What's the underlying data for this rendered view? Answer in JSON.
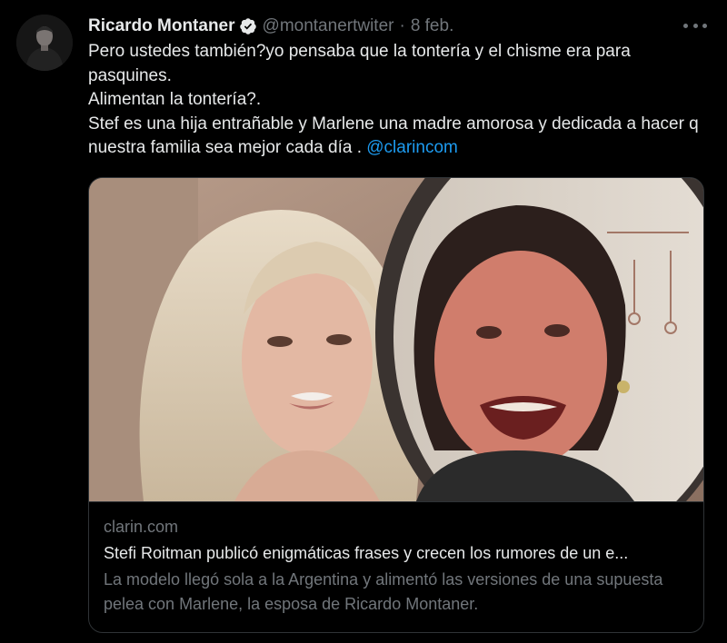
{
  "tweet": {
    "display_name": "Ricardo Montaner",
    "handle": "@montanertwiter",
    "separator": "·",
    "time": "8 feb.",
    "lines": [
      "Pero ustedes también?yo pensaba que la tontería y el chisme era para pasquines.",
      "Alimentan la tontería?.",
      "Stef es una hija entrañable y Marlene una madre amorosa y dedicada a hacer q nuestra familia sea mejor cada día . "
    ],
    "mention": "@clarincom"
  },
  "card": {
    "domain": "clarin.com",
    "title": "Stefi Roitman publicó enigmáticas frases y crecen los rumores de un e...",
    "description": "La modelo llegó sola a la Argentina y alimentó las versiones de una supuesta pelea con Marlene, la esposa de Ricardo Montaner."
  },
  "colors": {
    "background": "#000000",
    "text": "#e7e9ea",
    "secondary": "#71767b",
    "link": "#1d9bf0",
    "border": "#2f3336"
  },
  "icons": [
    "verified-badge-icon",
    "more-options-icon"
  ]
}
